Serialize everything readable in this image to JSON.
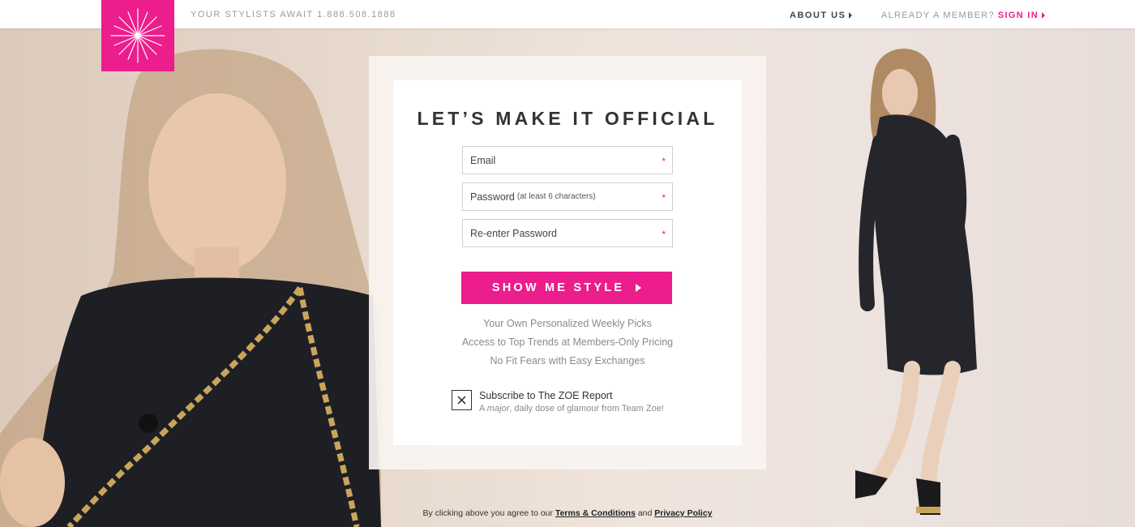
{
  "header": {
    "tagline": "YOUR STYLISTS AWAIT 1.888.508.1888",
    "about_label": "ABOUT US",
    "member_prompt": "ALREADY A MEMBER?",
    "signin_label": "SIGN IN"
  },
  "form": {
    "title": "LET’S MAKE IT OFFICIAL",
    "email_label": "Email",
    "password_label": "Password",
    "password_hint": "(at least 6 characters)",
    "reenter_label": "Re-enter Password",
    "required_mark": "*",
    "submit_label": "SHOW ME STYLE",
    "benefits": [
      "Your Own Personalized Weekly Picks",
      "Access to Top Trends at Members-Only Pricing",
      "No Fit Fears with Easy Exchanges"
    ],
    "subscribe": {
      "checked": true,
      "title": "Subscribe to The ZOE Report",
      "desc_prefix": "A ",
      "desc_em": "major",
      "desc_suffix": ", daily dose of glamour from Team Zoe!"
    }
  },
  "legal": {
    "prefix": "By clicking above you agree to our ",
    "terms": "Terms & Conditions",
    "and": " and ",
    "privacy": "Privacy Policy"
  },
  "colors": {
    "brand_pink": "#ec1d8c",
    "text_dark": "#333333",
    "text_muted": "#8a8a8a"
  },
  "icons": {
    "logo": "starburst-icon",
    "arrow": "triangle-right-icon",
    "checkbox": "x-icon"
  }
}
